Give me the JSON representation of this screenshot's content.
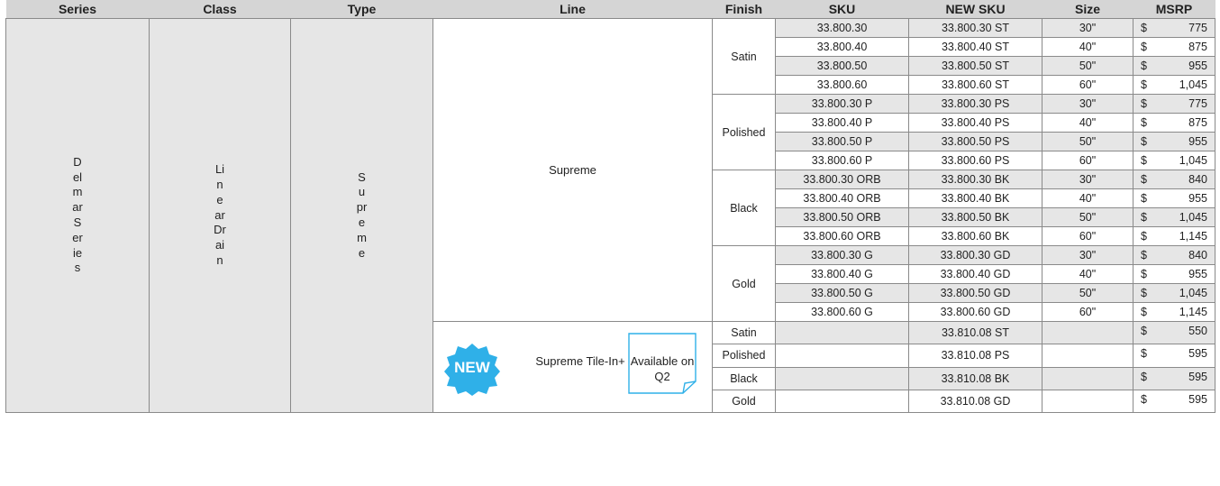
{
  "headers": [
    "Series",
    "Class",
    "Type",
    "Line",
    "Finish",
    "SKU",
    "NEW SKU",
    "Size",
    "MSRP"
  ],
  "series": "DelmarSeries",
  "class": "LinearDrain",
  "type": "Supreme",
  "supreme": {
    "line": "Supreme",
    "groups": [
      {
        "finish": "Satin",
        "rows": [
          {
            "sku": "33.800.30",
            "new_sku": "33.800.30 ST",
            "size": "30\"",
            "currency": "$",
            "msrp": "775"
          },
          {
            "sku": "33.800.40",
            "new_sku": "33.800.40 ST",
            "size": "40\"",
            "currency": "$",
            "msrp": "875"
          },
          {
            "sku": "33.800.50",
            "new_sku": "33.800.50 ST",
            "size": "50\"",
            "currency": "$",
            "msrp": "955"
          },
          {
            "sku": "33.800.60",
            "new_sku": "33.800.60 ST",
            "size": "60\"",
            "currency": "$",
            "msrp": "1,045"
          }
        ]
      },
      {
        "finish": "Polished",
        "rows": [
          {
            "sku": "33.800.30 P",
            "new_sku": "33.800.30 PS",
            "size": "30\"",
            "currency": "$",
            "msrp": "775"
          },
          {
            "sku": "33.800.40 P",
            "new_sku": "33.800.40 PS",
            "size": "40\"",
            "currency": "$",
            "msrp": "875"
          },
          {
            "sku": "33.800.50 P",
            "new_sku": "33.800.50 PS",
            "size": "50\"",
            "currency": "$",
            "msrp": "955"
          },
          {
            "sku": "33.800.60 P",
            "new_sku": "33.800.60 PS",
            "size": "60\"",
            "currency": "$",
            "msrp": "1,045"
          }
        ]
      },
      {
        "finish": "Black",
        "rows": [
          {
            "sku": "33.800.30 ORB",
            "new_sku": "33.800.30 BK",
            "size": "30\"",
            "currency": "$",
            "msrp": "840"
          },
          {
            "sku": "33.800.40 ORB",
            "new_sku": "33.800.40 BK",
            "size": "40\"",
            "currency": "$",
            "msrp": "955"
          },
          {
            "sku": "33.800.50 ORB",
            "new_sku": "33.800.50 BK",
            "size": "50\"",
            "currency": "$",
            "msrp": "1,045"
          },
          {
            "sku": "33.800.60 ORB",
            "new_sku": "33.800.60 BK",
            "size": "60\"",
            "currency": "$",
            "msrp": "1,145"
          }
        ]
      },
      {
        "finish": "Gold",
        "rows": [
          {
            "sku": "33.800.30 G",
            "new_sku": "33.800.30 GD",
            "size": "30\"",
            "currency": "$",
            "msrp": "840"
          },
          {
            "sku": "33.800.40 G",
            "new_sku": "33.800.40 GD",
            "size": "40\"",
            "currency": "$",
            "msrp": "955"
          },
          {
            "sku": "33.800.50 G",
            "new_sku": "33.800.50 GD",
            "size": "50\"",
            "currency": "$",
            "msrp": "1,045"
          },
          {
            "sku": "33.800.60 G",
            "new_sku": "33.800.60 GD",
            "size": "60\"",
            "currency": "$",
            "msrp": "1,145"
          }
        ]
      }
    ]
  },
  "tilein": {
    "badge": "NEW",
    "line": "Supreme Tile-In+",
    "availability": "Available on Q2",
    "rows": [
      {
        "finish": "Satin",
        "sku": "",
        "new_sku": "33.810.08 ST",
        "size": "",
        "currency": "$",
        "msrp": "550"
      },
      {
        "finish": "Polished",
        "sku": "",
        "new_sku": "33.810.08 PS",
        "size": "",
        "currency": "$",
        "msrp": "595"
      },
      {
        "finish": "Black",
        "sku": "",
        "new_sku": "33.810.08 BK",
        "size": "",
        "currency": "$",
        "msrp": "595"
      },
      {
        "finish": "Gold",
        "sku": "",
        "new_sku": "33.810.08 GD",
        "size": "",
        "currency": "$",
        "msrp": "595"
      }
    ]
  },
  "colors": {
    "header_bg": "#d5d5d5",
    "row_gray": "#e6e6e6",
    "badge_blue": "#2fb0e8",
    "note_border": "#2fb0e8"
  }
}
